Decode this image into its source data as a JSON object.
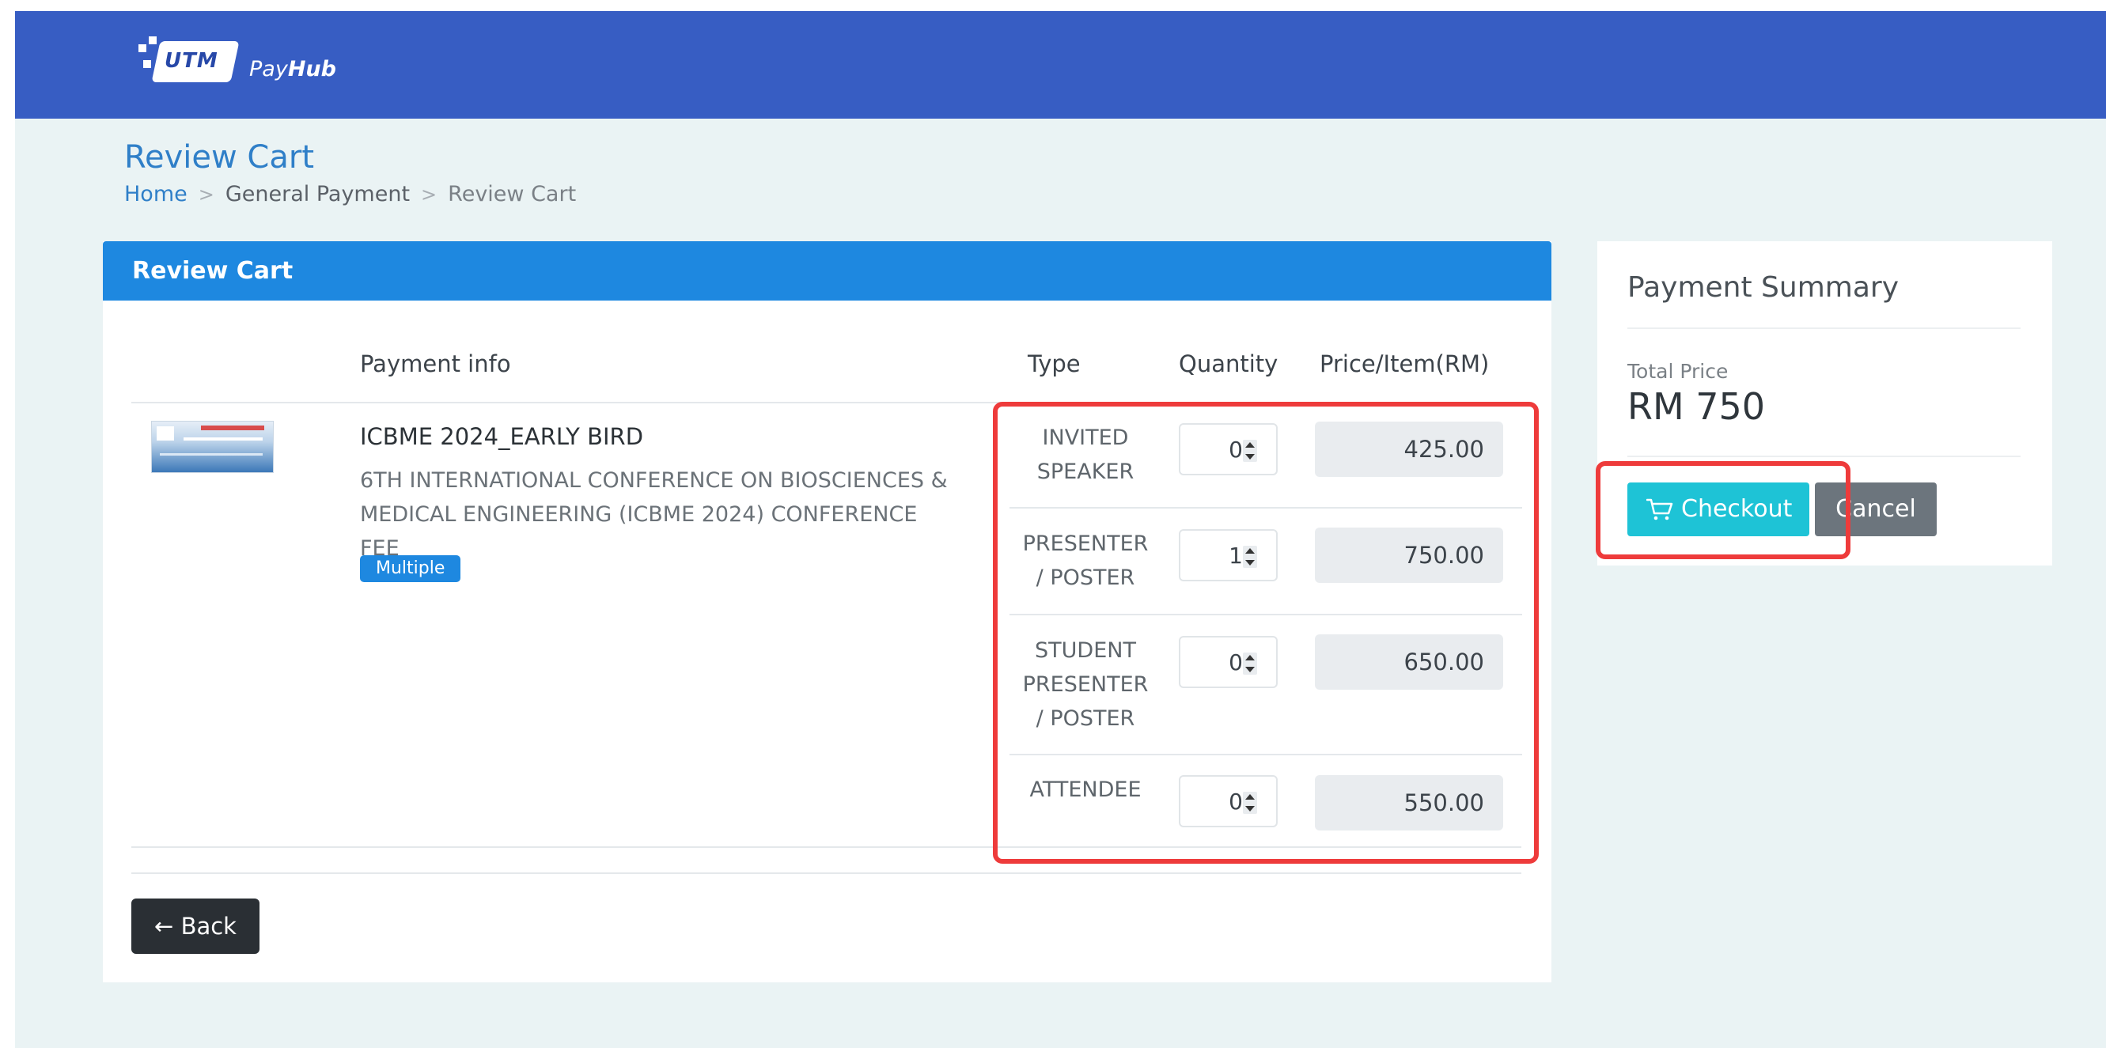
{
  "header": {
    "logo_utm": "UTM",
    "logo_pay": "Pay",
    "logo_hub": "Hub",
    "bg_color": "#375dc3"
  },
  "page": {
    "title": "Review Cart",
    "breadcrumb": [
      "Home",
      "General Payment",
      "Review Cart"
    ]
  },
  "cart": {
    "header_title": "Review Cart",
    "columns": [
      "Payment info",
      "Type",
      "Quantity",
      "Price/Item(RM)"
    ],
    "item": {
      "title": "ICBME 2024_EARLY BIRD",
      "description": "6TH INTERNATIONAL CONFERENCE ON BIOSCIENCES & MEDICAL ENGINEERING (ICBME 2024) CONFERENCE FEE",
      "badge": "Multiple",
      "options": [
        {
          "type": "INVITED SPEAKER",
          "quantity": "0",
          "price": "425.00"
        },
        {
          "type": "PRESENTER / POSTER",
          "quantity": "1",
          "price": "750.00"
        },
        {
          "type": "STUDENT PRESENTER / POSTER",
          "quantity": "0",
          "price": "650.00"
        },
        {
          "type": "ATTENDEE",
          "quantity": "0",
          "price": "550.00"
        }
      ]
    },
    "back_label": "Back",
    "back_icon": "arrow-left-icon"
  },
  "summary": {
    "title": "Payment Summary",
    "total_label": "Total Price",
    "total_value": "RM 750",
    "checkout_label": "Checkout",
    "checkout_icon": "cart-icon",
    "cancel_label": "Cancel"
  },
  "colors": {
    "accent_blue": "#1e88e0",
    "checkout": "#1ec3d6",
    "cancel": "#6c757d",
    "highlight": "#ee3b3b"
  }
}
